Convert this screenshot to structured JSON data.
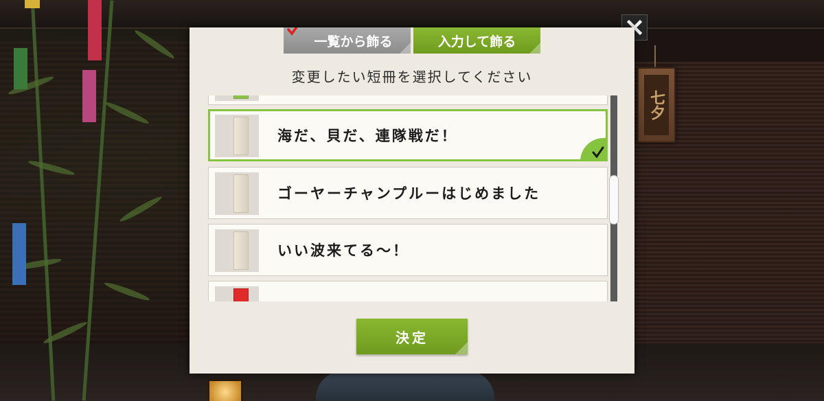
{
  "dialog": {
    "tabs": [
      {
        "label": "一覧から飾る",
        "active": true
      },
      {
        "label": "入力して飾る",
        "active": false
      }
    ],
    "subtitle": "変更したい短冊を選択してください",
    "items": [
      {
        "text": "",
        "strip_color": "#8bc34a"
      },
      {
        "text": "海だ、貝だ、連隊戦だ！",
        "strip_color": "#ece4d4",
        "selected": true
      },
      {
        "text": "ゴーヤーチャンプルーはじめました",
        "strip_color": "#ece4d4",
        "selected": false
      },
      {
        "text": "いい波来てる～！",
        "strip_color": "#ece4d4",
        "selected": false
      },
      {
        "text": "",
        "strip_color": "#e02b2b",
        "selected": false
      }
    ],
    "confirm_label": "決定"
  },
  "background": {
    "plaque_text": "七夕"
  },
  "colors": {
    "accent_green": "#86c440",
    "button_green": "#7aa826",
    "tab_inactive": "#9b9b9b",
    "panel": "#eeeae1"
  },
  "icons": {
    "close": "close-icon",
    "check": "check-icon",
    "tab_check": "red-check-icon"
  }
}
